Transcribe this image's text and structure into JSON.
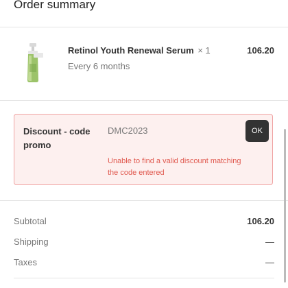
{
  "header": {
    "title": "Order summary"
  },
  "product": {
    "name": "Retinol Youth Renewal Serum",
    "quantity": "× 1",
    "frequency": "Every 6 months",
    "price": "106.20",
    "thumbnail_icon": "serum-bottle-icon"
  },
  "discount": {
    "label": "Discount - code promo",
    "code_value": "DMC2023",
    "ok_label": "OK",
    "error_message": "Unable to find a valid discount matching the code entered",
    "error_color": "#e05a50",
    "border_color": "#f0a3a3",
    "background_color": "#fdf0ef"
  },
  "totals": {
    "subtotal_label": "Subtotal",
    "subtotal_value": "106.20",
    "shipping_label": "Shipping",
    "shipping_value": "—",
    "taxes_label": "Taxes",
    "taxes_value": "—"
  },
  "colors": {
    "button_background": "#333333",
    "text_primary": "#333333",
    "text_secondary": "#777777"
  }
}
